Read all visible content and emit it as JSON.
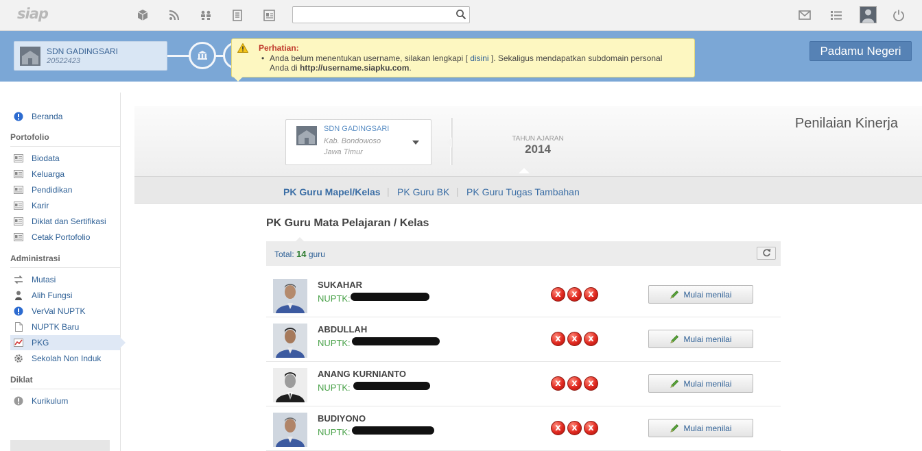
{
  "app": {
    "logo": "siap",
    "search_placeholder": ""
  },
  "topbar_icons": [
    "package-icon",
    "rss-icon",
    "people-icon",
    "document-icon",
    "id-card-icon",
    "mail-icon",
    "list-icon",
    "user-avatar-icon",
    "power-icon"
  ],
  "school": {
    "name": "SDN GADINGSARI",
    "npsn": "20522423"
  },
  "alert": {
    "title": "Perhatian:",
    "text_before": "Anda belum menentukan username, silakan lengkapi [ ",
    "link": "disini",
    "text_after": " ]. Sekaligus mendapatkan subdomain personal Anda di ",
    "url": "http://username.siapku.com",
    "end": "."
  },
  "padamu_label": "Padamu Negeri",
  "sidebar": {
    "beranda": "Beranda",
    "portofolio_header": "Portofolio",
    "portofolio_items": [
      "Biodata",
      "Keluarga",
      "Pendidikan",
      "Karir",
      "Diklat dan Sertifikasi",
      "Cetak Portofolio"
    ],
    "administrasi_header": "Administrasi",
    "administrasi_items": [
      "Mutasi",
      "Alih Fungsi",
      "VerVal NUPTK",
      "NUPTK Baru",
      "PKG",
      "Sekolah Non Induk"
    ],
    "diklat_header": "Diklat",
    "diklat_items": [
      "Kurikulum"
    ],
    "active": "PKG"
  },
  "selector": {
    "name": "SDN GADINGSARI",
    "kab": "Kab. Bondowoso",
    "prov": "Jawa Timur"
  },
  "tahun_ajaran": {
    "label": "TAHUN AJARAN",
    "year": "2014"
  },
  "page_title": "Penilaian Kinerja",
  "tabs": [
    "PK Guru Mapel/Kelas",
    "PK Guru BK",
    "PK Guru Tugas Tambahan"
  ],
  "active_tab": "PK Guru Mapel/Kelas",
  "section_title": "PK Guru Mata Pelajaran / Kelas",
  "total": {
    "label": "Total:",
    "count": "14",
    "unit": "guru"
  },
  "teachers": [
    {
      "name": "SUKAHAR",
      "nuptk_label": "NUPTK:",
      "status": [
        "x",
        "x",
        "x"
      ],
      "action": "Mulai menilai"
    },
    {
      "name": "ABDULLAH",
      "nuptk_label": "NUPTK:",
      "status": [
        "x",
        "x",
        "x"
      ],
      "action": "Mulai menilai"
    },
    {
      "name": "ANANG KURNIANTO",
      "nuptk_label": "NUPTK:",
      "status": [
        "x",
        "x",
        "x"
      ],
      "action": "Mulai menilai"
    },
    {
      "name": "BUDIYONO",
      "nuptk_label": "NUPTK:",
      "status": [
        "x",
        "x",
        "x"
      ],
      "action": "Mulai menilai"
    }
  ],
  "colors": {
    "band": "#7ba7d6",
    "link": "#2d5f95",
    "nuptk_green": "#4aa24a",
    "status_red": "#e0281f"
  }
}
